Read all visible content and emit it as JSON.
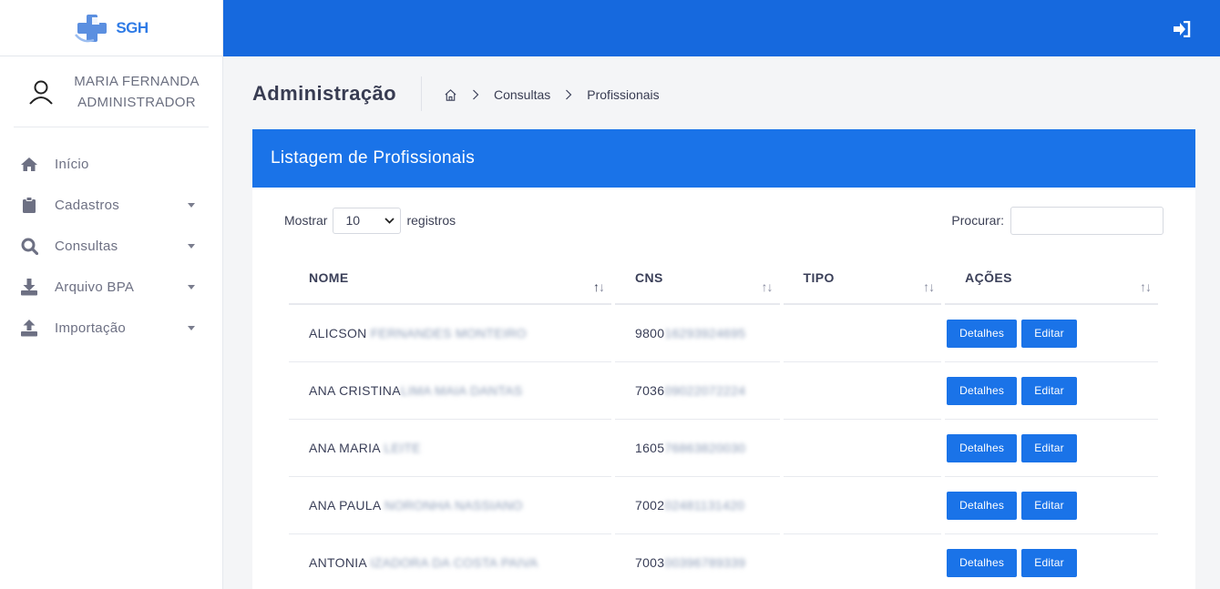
{
  "app": {
    "logo_text": "SGH"
  },
  "user": {
    "name": "MARIA FERNANDA",
    "role": "ADMINISTRADOR"
  },
  "sidebar": {
    "items": [
      {
        "label": "Início",
        "icon": "home-icon",
        "has_caret": false
      },
      {
        "label": "Cadastros",
        "icon": "clipboard-icon",
        "has_caret": true
      },
      {
        "label": "Consultas",
        "icon": "search-icon",
        "has_caret": true
      },
      {
        "label": "Arquivo BPA",
        "icon": "download-icon",
        "has_caret": true
      },
      {
        "label": "Importação",
        "icon": "upload-icon",
        "has_caret": true
      }
    ]
  },
  "header": {
    "title": "Administração",
    "breadcrumb": [
      "Consultas",
      "Profissionais"
    ]
  },
  "card": {
    "title": "Listagem de Profissionais",
    "show_label": "Mostrar",
    "page_size": "10",
    "records_label": "registros",
    "search_label": "Procurar:",
    "search_value": ""
  },
  "table": {
    "columns": [
      "NOME",
      "CNS",
      "TIPO",
      "AÇÕES"
    ],
    "rows": [
      {
        "name": "ALICSON",
        "name_hidden": "FERNANDES MONTEIRO",
        "cns": "9800",
        "cns_hidden": "16293924695",
        "tipo": ""
      },
      {
        "name": "ANA CRISTINA",
        "name_hidden": "LIMA MAIA DANTAS",
        "cns": "7036",
        "cns_hidden": "09022072224",
        "tipo": ""
      },
      {
        "name": "ANA MARIA",
        "name_hidden": "LEITE",
        "cns": "1605",
        "cns_hidden": "76863820030",
        "tipo": ""
      },
      {
        "name": "ANA PAULA",
        "name_hidden": "NORONHA NASSIANO",
        "cns": "7002",
        "cns_hidden": "02481131420",
        "tipo": ""
      },
      {
        "name": "ANTONIA",
        "name_hidden": "IZADORA DA COSTA PAIVA",
        "cns": "7003",
        "cns_hidden": "00396789339",
        "tipo": ""
      }
    ],
    "details_label": "Detalhes",
    "edit_label": "Editar"
  }
}
